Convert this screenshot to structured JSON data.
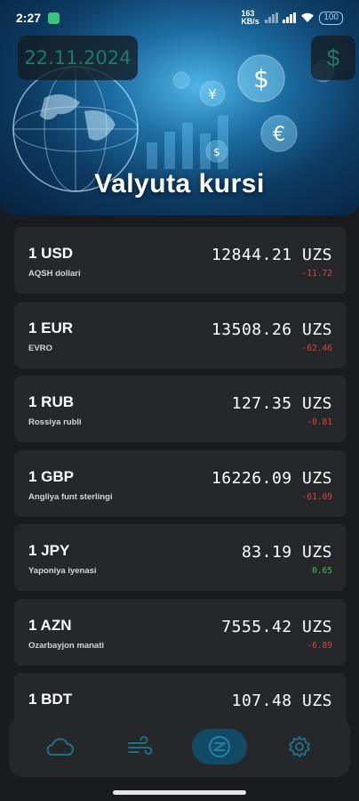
{
  "status_bar": {
    "time": "2:27",
    "network_speed": "163 KB/s",
    "battery": "100"
  },
  "header": {
    "date": "22.11.2024",
    "currency_symbol": "$",
    "title": "Valyuta kursi"
  },
  "unit": "UZS",
  "rates": [
    {
      "code": "1 USD",
      "name": "AQSH dollari",
      "value": "12844.21",
      "change": "-11.72",
      "direction": "down"
    },
    {
      "code": "1 EUR",
      "name": "EVRO",
      "value": "13508.26",
      "change": "-62.46",
      "direction": "down"
    },
    {
      "code": "1 RUB",
      "name": "Rossiya rubli",
      "value": "127.35",
      "change": "-0.81",
      "direction": "down"
    },
    {
      "code": "1 GBP",
      "name": "Angliya funt sterlingi",
      "value": "16226.09",
      "change": "-61.09",
      "direction": "down"
    },
    {
      "code": "1 JPY",
      "name": "Yaponiya iyenasi",
      "value": "83.19",
      "change": "0.65",
      "direction": "up"
    },
    {
      "code": "1 AZN",
      "name": "Ozarbayjon manati",
      "value": "7555.42",
      "change": "-6.89",
      "direction": "down"
    },
    {
      "code": "1 BDT",
      "name": "",
      "value": "107.48",
      "change": "",
      "direction": "down"
    }
  ],
  "nav": [
    {
      "icon": "cloud-icon",
      "active": false
    },
    {
      "icon": "wind-icon",
      "active": false
    },
    {
      "icon": "currency-exchange-icon",
      "active": true
    },
    {
      "icon": "gear-icon",
      "active": false
    }
  ],
  "colors": {
    "accent": "#1f7a66",
    "negative": "#e0453b",
    "positive": "#3fbf5a",
    "card": "#25272b",
    "background": "#1a1b1e",
    "nav_active": "#124a66"
  }
}
